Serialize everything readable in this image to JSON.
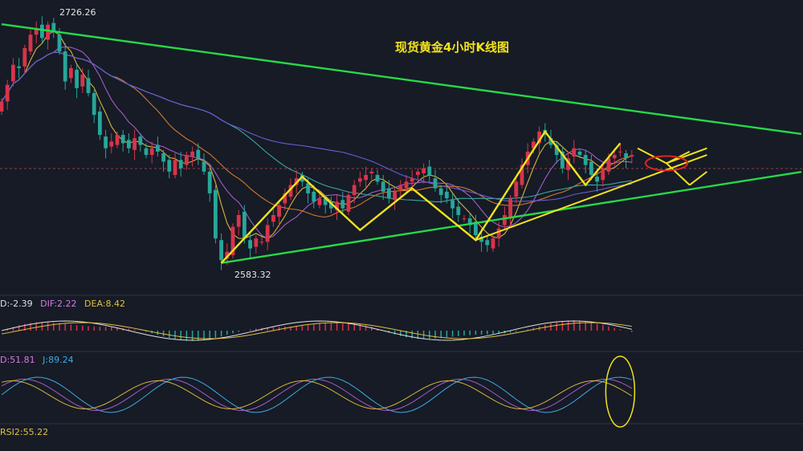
{
  "title": "现货黄金4小时K线图",
  "price_labels": {
    "high": "2726.26",
    "low": "2583.32"
  },
  "indicators": {
    "macd": {
      "dif_a": "D:-2.39",
      "dif_b": "DIF:2.22",
      "dea": "DEA:8.42"
    },
    "kdj": {
      "d": "D:51.81",
      "j": "J:89.24"
    },
    "rsi": {
      "rsi2": "RSI2:55.22"
    }
  },
  "colors": {
    "background": "#161b26",
    "up": "#d8344a",
    "down": "#27a69a",
    "trendline": "#27d84a",
    "arrow": "#f2e21c",
    "ellipse": "#e02424",
    "ma_yellow": "#d9b33c",
    "ma_purple": "#a45cc9",
    "ma_orange": "#d2782c",
    "ma_teal": "#3ba6a0",
    "ma_violet": "#6b5bd6",
    "kdj_blue": "#3fa9e0",
    "macd_dif": "#e0e0e0",
    "macd_dea": "#e0c040"
  },
  "chart_data": {
    "type": "candlestick",
    "title": "现货黄金4小时K线图",
    "annotations": [
      "2726.26",
      "2583.32"
    ],
    "price_range": [
      2575,
      2735
    ],
    "trend_lines": [
      {
        "name": "upper",
        "from": [
          0,
          2726.26
        ],
        "to": [
          130,
          2662
        ]
      },
      {
        "name": "lower",
        "from": [
          38,
          2583.32
        ],
        "to": [
          130,
          2634
        ]
      }
    ],
    "closes": [
      2680,
      2690,
      2702,
      2700,
      2712,
      2720,
      2724,
      2718,
      2726,
      2722,
      2710,
      2692,
      2700,
      2688,
      2696,
      2685,
      2672,
      2660,
      2652,
      2656,
      2660,
      2655,
      2652,
      2658,
      2654,
      2648,
      2652,
      2650,
      2644,
      2638,
      2645,
      2640,
      2648,
      2650,
      2646,
      2638,
      2625,
      2598,
      2585,
      2590,
      2605,
      2612,
      2598,
      2592,
      2598,
      2596,
      2606,
      2612,
      2618,
      2625,
      2630,
      2634,
      2632,
      2625,
      2620,
      2622,
      2618,
      2616,
      2620,
      2616,
      2624,
      2630,
      2634,
      2636,
      2638,
      2632,
      2626,
      2622,
      2626,
      2630,
      2632,
      2634,
      2638,
      2640,
      2636,
      2628,
      2624,
      2622,
      2616,
      2612,
      2610,
      2606,
      2600,
      2596,
      2594,
      2598,
      2604,
      2612,
      2622,
      2632,
      2642,
      2650,
      2656,
      2662,
      2660,
      2654,
      2648,
      2640,
      2646,
      2652,
      2648,
      2642,
      2636,
      2632,
      2640,
      2646,
      2648,
      2650,
      2646,
      2648
    ],
    "macd": {
      "dif": -2.39,
      "dif2": 2.22,
      "dea": 8.42
    },
    "kdj": {
      "d": 51.81,
      "j": 89.24
    },
    "rsi": {
      "rsi2": 55.22
    }
  }
}
